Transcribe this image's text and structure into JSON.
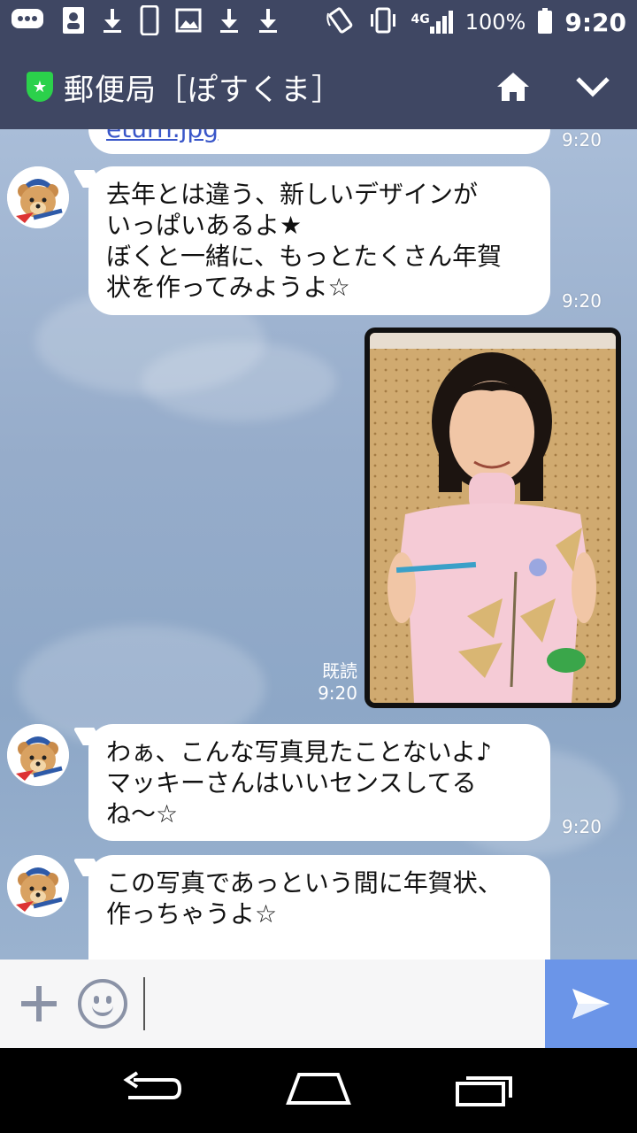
{
  "status_bar": {
    "network": "4G",
    "battery": "100%",
    "time": "9:20"
  },
  "header": {
    "title": "郵便局［ぽすくま］"
  },
  "messages": {
    "m0": {
      "link": "eturn.jpg",
      "time": "9:20"
    },
    "m1": {
      "lines": [
        "去年とは違う、新しいデザインが",
        "いっぱいあるよ★",
        "ぼくと一緒に、もっとたくさん年賀",
        "状を作ってみようよ☆"
      ],
      "time": "9:20"
    },
    "m2": {
      "read": "既読",
      "time": "9:20"
    },
    "m3": {
      "lines": [
        "わぁ、こんな写真見たことないよ♪",
        "マッキーさんはいいセンスしてる",
        "ね〜☆"
      ],
      "time": "9:20"
    },
    "m4": {
      "lines": [
        "この写真であっという間に年賀状、",
        "作っちゃうよ☆"
      ]
    }
  },
  "colors": {
    "header_bg": "#3f4763",
    "send_button": "#6b95e8",
    "shield": "#2bd14b"
  }
}
